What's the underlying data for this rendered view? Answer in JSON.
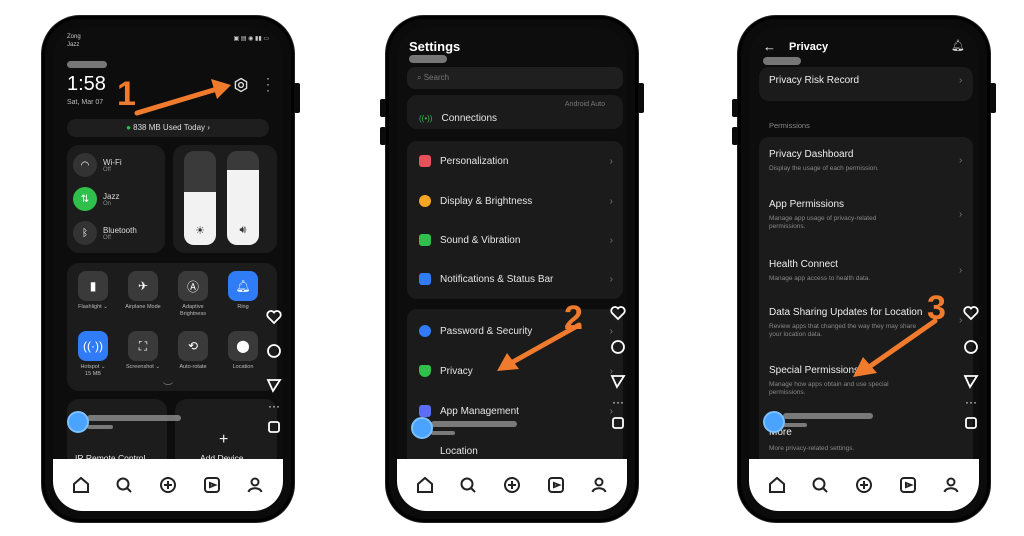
{
  "steps": [
    "1",
    "2",
    "3"
  ],
  "phone1": {
    "carrier_line1": "Zong",
    "carrier_line2": "Jazz",
    "time": "1:58",
    "date": "Sat, Mar 07",
    "data_usage": "838 MB Used Today",
    "wifi": {
      "label": "Wi-Fi",
      "state": "Off"
    },
    "mobile": {
      "label": "Jazz",
      "state": "On"
    },
    "bluetooth": {
      "label": "Bluetooth",
      "state": "Off"
    },
    "tiles": [
      "Flashlight",
      "Airplane Mode",
      "Adaptive Brightness",
      "Ring",
      "Hotspot",
      "Screenshot",
      "Auto-rotate",
      "Location"
    ],
    "hotspot_sub": "15 MB",
    "ir_label": "IR Remote Control",
    "add_device": "Add Device"
  },
  "phone2": {
    "title": "Settings",
    "search_placeholder": "Search",
    "connections": "Connections",
    "android_auto": "Android Auto",
    "group1": [
      "Personalization",
      "Display & Brightness",
      "Sound & Vibration",
      "Notifications & Status Bar"
    ],
    "group2": [
      "Password & Security",
      "Privacy",
      "App Management",
      "Location"
    ],
    "colors": {
      "personalization": "#e8505b",
      "display": "#f5a623",
      "sound": "#2fbf4b",
      "notifications": "#2f7cf6",
      "password": "#2f7cf6",
      "privacy": "#2fbf4b",
      "apps": "#5b6cf6",
      "location": "#2f7cf6"
    }
  },
  "phone3": {
    "title": "Privacy",
    "risk_record": "Privacy Risk Record",
    "section": "Permissions",
    "items": [
      {
        "title": "Privacy Dashboard",
        "desc": "Display the usage of each permission."
      },
      {
        "title": "App Permissions",
        "desc": "Manage app usage of privacy-related permissions."
      },
      {
        "title": "Health Connect",
        "desc": "Manage app access to health data."
      },
      {
        "title": "Data Sharing Updates for Location",
        "desc": "Review apps that changed the way they may share your location data."
      },
      {
        "title": "Special Permissions",
        "desc": "Manage how apps obtain and use special permissions."
      },
      {
        "title": "More",
        "desc": "More privacy-related settings."
      }
    ]
  },
  "accent": "#f07b2d"
}
